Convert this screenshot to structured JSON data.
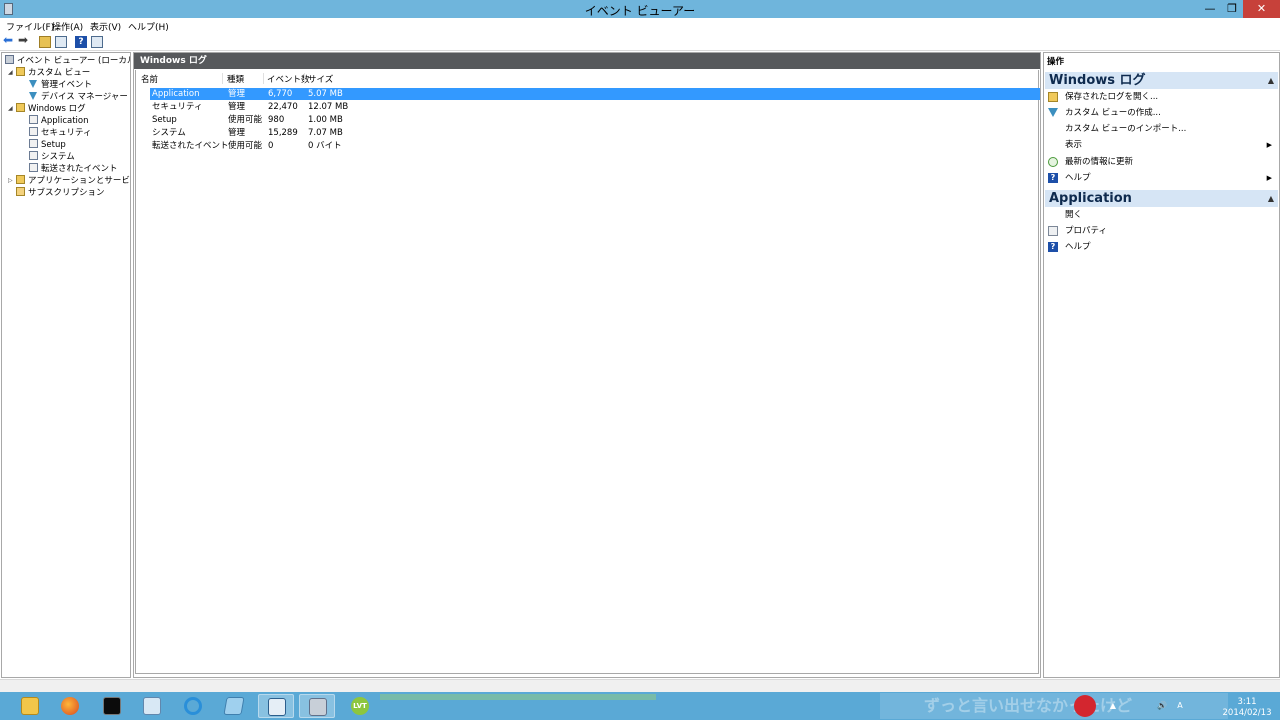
{
  "window": {
    "title": "イベント ビューアー",
    "min_glyph": "—",
    "max_glyph": "❐",
    "close_glyph": "✕"
  },
  "menu": [
    "ファイル(F)",
    "操作(A)",
    "表示(V)",
    "ヘルプ(H)"
  ],
  "toolbar": {
    "back_glyph": "⬅",
    "forward_glyph": "➡",
    "help_glyph": "?"
  },
  "tree": {
    "root": "イベント ビューアー (ローカル)",
    "custom_views": "カスタム ビュー",
    "admin_events": "管理イベント",
    "device_manager": "デバイス マネージャー - 汎用",
    "windows_logs": "Windows ログ",
    "application": "Application",
    "security": "セキュリティ",
    "setup": "Setup",
    "system": "システム",
    "forwarded": "転送されたイベント",
    "app_service_logs": "アプリケーションとサービス ログ",
    "subscriptions": "サブスクリプション",
    "expand_open": "◢",
    "expand_closed": "▷",
    "scroll_left": "‹",
    "scroll_right": "›"
  },
  "center": {
    "header": "Windows ログ",
    "columns": [
      "名前",
      "種類",
      "イベント数",
      "サイズ"
    ],
    "rows": [
      {
        "name": "Application",
        "type": "管理",
        "count": "6,770",
        "size": "5.07 MB",
        "selected": true
      },
      {
        "name": "セキュリティ",
        "type": "管理",
        "count": "22,470",
        "size": "12.07 MB"
      },
      {
        "name": "Setup",
        "type": "使用可能",
        "count": "980",
        "size": "1.00 MB"
      },
      {
        "name": "システム",
        "type": "管理",
        "count": "15,289",
        "size": "7.07 MB"
      },
      {
        "name": "転送されたイベント",
        "type": "使用可能",
        "count": "0",
        "size": "0 バイト"
      }
    ]
  },
  "actions": {
    "title": "操作",
    "collapse_glyph": "▲",
    "submenu_glyph": "▶",
    "help_glyph": "?",
    "sections": [
      {
        "title": "Windows ログ",
        "items": [
          "保存されたログを開く...",
          "カスタム ビューの作成...",
          "カスタム ビューのインポート...",
          "表示",
          "最新の情報に更新",
          "ヘルプ"
        ]
      },
      {
        "title": "Application",
        "items": [
          "開く",
          "プロパティ",
          "ヘルプ"
        ]
      }
    ]
  },
  "taskbar": {
    "banner_text": "ずっと言い出せなかったけど",
    "lvt_label": "LVT",
    "tray": {
      "chevron": "▲",
      "ime": "A",
      "volume": "🔊"
    },
    "clock_time": "3:11",
    "clock_date": "2014/02/13"
  },
  "colors": {
    "titlebar": "#6fb5dc",
    "selection": "#3399ff",
    "close": "#c7413a",
    "taskbar": "#5aa9d6",
    "section_header": "#d6e5f5"
  }
}
